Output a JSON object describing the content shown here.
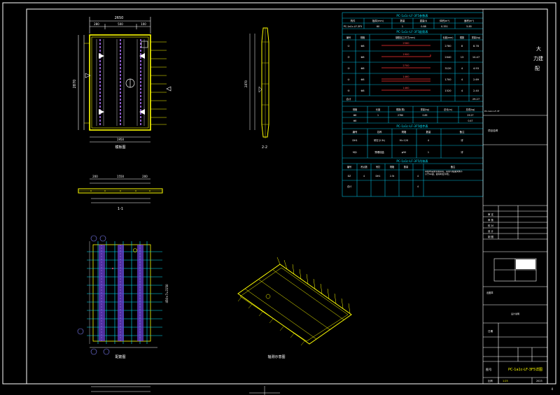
{
  "title_block": {
    "company_line1": "大",
    "company_line2": "力建",
    "company_line3": "配",
    "small_note": "PC-1a1c-LF-3F",
    "project_label": "项目名称",
    "drawing_name": "PC-1a1c-LF-3F5详图",
    "scale_label": "比例",
    "scale_value": "1:25",
    "page_number": "4",
    "rows": [
      "审 定",
      "审 核",
      "校 对",
      "设 计",
      "制 图"
    ],
    "stamp_label": "出图章",
    "date_label": "日期",
    "sheet_label": "图号",
    "sheet_value": "2023"
  },
  "views": {
    "plan_label": "模板图",
    "section_22": "2-2",
    "section_11": "1-1",
    "rebar_label": "配筋图",
    "iso_label": "轴测示意图"
  },
  "dims": {
    "top_total": "2650",
    "top_a": "280",
    "top_b": "500",
    "top_c": "100",
    "left_total": "2870",
    "bottom_total": "1950",
    "side_total": "2870",
    "s11_a": "200",
    "s11_b": "1550",
    "s11_c": "200",
    "rebar_total": "2650",
    "rebar_right": "450×7=3150"
  },
  "table1": {
    "title": "PC-1a1c-LF-3F5参数表",
    "headers": [
      "构件",
      "板厚(mm)",
      "数量",
      "重量(t)",
      "体积(m³)",
      "面积(m²)"
    ],
    "row": [
      "PC-1a1c-LF-3F5",
      "60",
      "1",
      "0.88",
      "0.351",
      "5.85"
    ]
  },
  "table2": {
    "title": "PC-1a1c-LF-3F5配筋表",
    "headers": [
      "编号",
      "规格",
      "钢筋加工尺寸(mm)",
      "长度(mm)",
      "根数",
      "重量(kg)"
    ],
    "rows": [
      [
        "①",
        "Φ8",
        "2560",
        "2780",
        "8",
        "8.78"
      ],
      [
        "②",
        "Φ8",
        "1900",
        "2040",
        "13",
        "10.47"
      ],
      [
        "③",
        "Φ8",
        "2700",
        "3120",
        "4",
        "4.93"
      ],
      [
        "④",
        "Φ8",
        "1460",
        "1700",
        "4",
        "2.69"
      ],
      [
        "⑤",
        "Φ8",
        "1460",
        "1520",
        "4",
        "2.40"
      ]
    ],
    "total_label": "合计",
    "total_value": "29.27"
  },
  "table3": {
    "headers": [
      "规格",
      "长度",
      "根数(根)",
      "重量(kg)",
      "总长(m)",
      "总重(kg)"
    ],
    "rows": [
      [
        "Φ8",
        "1",
        "2780",
        "0.85",
        "",
        "29.27"
      ],
      [
        "Φ8",
        "",
        "",
        "",
        "",
        "0.47"
      ]
    ]
  },
  "table4": {
    "title": "PC-1a1c-LF-3F5埋件表",
    "headers": [
      "编号",
      "名称",
      "规格",
      "数量",
      "备注"
    ],
    "rows": [
      [
        "DH1",
        "吊钉(2.5t)",
        "M=120",
        "4",
        "详"
      ],
      [
        "MJ1",
        "预埋线盒",
        "φ50",
        "1",
        "详"
      ]
    ]
  },
  "table5": {
    "title": "PC-1a1c-LF-3F5吊装表",
    "headers": [
      "编号",
      "吊点数",
      "吊钉",
      "规格",
      "数量",
      "备注"
    ],
    "note": "吊装时采用专用吊具，吊索与板面夹角不小于60度，起吊时应平稳。",
    "rows": [
      [
        "DZ",
        "4",
        "DH1",
        "2.5t",
        "4"
      ],
      [
        "合计",
        "",
        "",
        "",
        "4"
      ]
    ]
  },
  "misc": {
    "note_text": "板底粗糙面做法详见说明",
    "drawing_no_label": "设计说明"
  }
}
